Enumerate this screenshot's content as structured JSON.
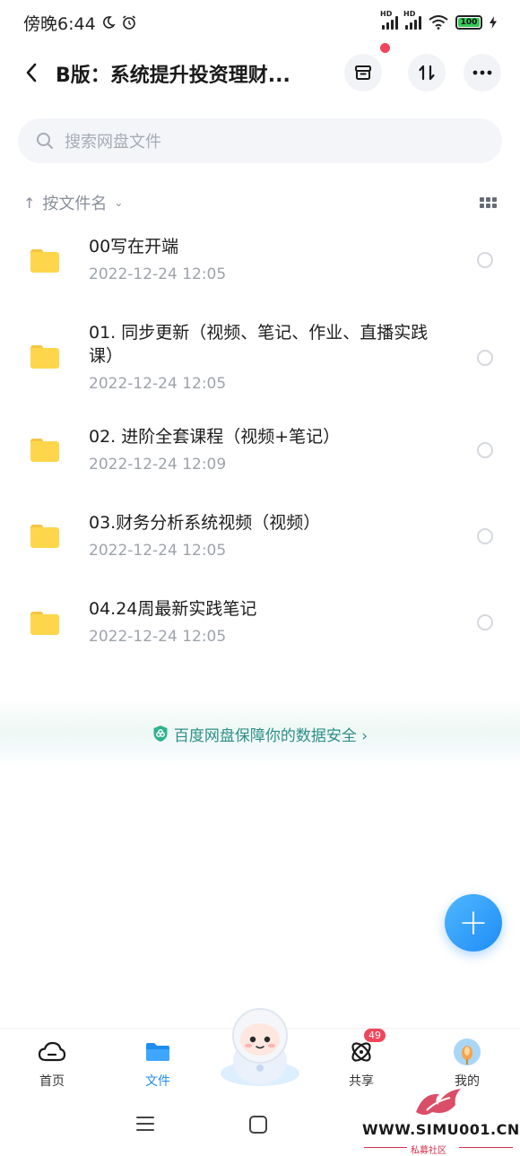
{
  "status_bar": {
    "time": "傍晚6:44",
    "battery": "100",
    "signal_1_label": "HD",
    "signal_2_label": "HD"
  },
  "header": {
    "title": "B版：系统提升投资理财..."
  },
  "search": {
    "placeholder": "搜索网盘文件"
  },
  "sort": {
    "label": "按文件名"
  },
  "files": [
    {
      "name": "00写在开端",
      "date": "2022-12-24  12:05"
    },
    {
      "name": "01. 同步更新（视频、笔记、作业、直播实践课）",
      "date": "2022-12-24  12:05"
    },
    {
      "name": "02. 进阶全套课程（视频+笔记）",
      "date": "2022-12-24  12:09"
    },
    {
      "name": "03.财务分析系统视频（视频）",
      "date": "2022-12-24  12:05"
    },
    {
      "name": "04.24周最新实践笔记",
      "date": "2022-12-24  12:05"
    }
  ],
  "banner": {
    "text": "百度网盘保障你的数据安全 ›"
  },
  "fab": {
    "label": "+"
  },
  "bottom_nav": {
    "home": "首页",
    "files": "文件",
    "share": "共享",
    "share_badge": "49",
    "me": "我的"
  },
  "watermark": {
    "text": "WWW.SIMU001.CN",
    "sub": "私募社区"
  },
  "colors": {
    "accent": "#1e8df0",
    "folder": "#fdd64c",
    "badge": "#f0455b",
    "banner_text": "#2e8f88"
  }
}
